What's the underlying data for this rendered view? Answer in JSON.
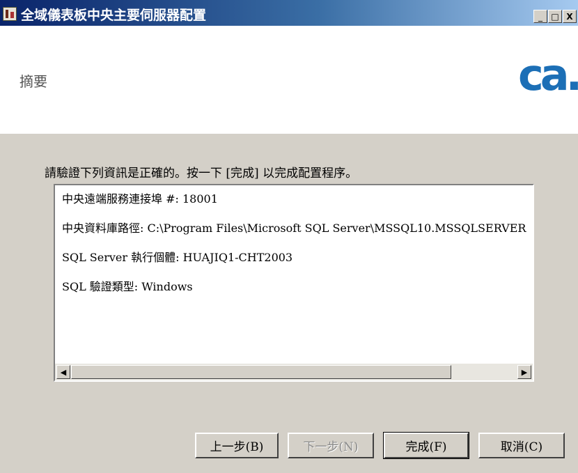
{
  "window": {
    "title": "全域儀表板中央主要伺服器配置",
    "minimize": "_",
    "maximize": "□",
    "close": "X",
    "icon": "app-icon"
  },
  "header": {
    "title": "摘要",
    "logo": "ca."
  },
  "main": {
    "instruction": "請驗證下列資訊是正確的。按一下 [完成] 以完成配置程序。",
    "summary_lines": [
      "中央遠端服務連接埠 #: 18001",
      "中央資料庫路徑: C:\\Program Files\\Microsoft SQL Server\\MSSQL10.MSSQLSERVER",
      "SQL Server 執行個體: HUAJIQ1-CHT2003",
      "SQL 驗證類型: Windows"
    ],
    "scroll_left": "◀",
    "scroll_right": "▶"
  },
  "buttons": {
    "back": "上一步(B)",
    "next": "下一步(N)",
    "finish": "完成(F)",
    "cancel": "取消(C)"
  }
}
